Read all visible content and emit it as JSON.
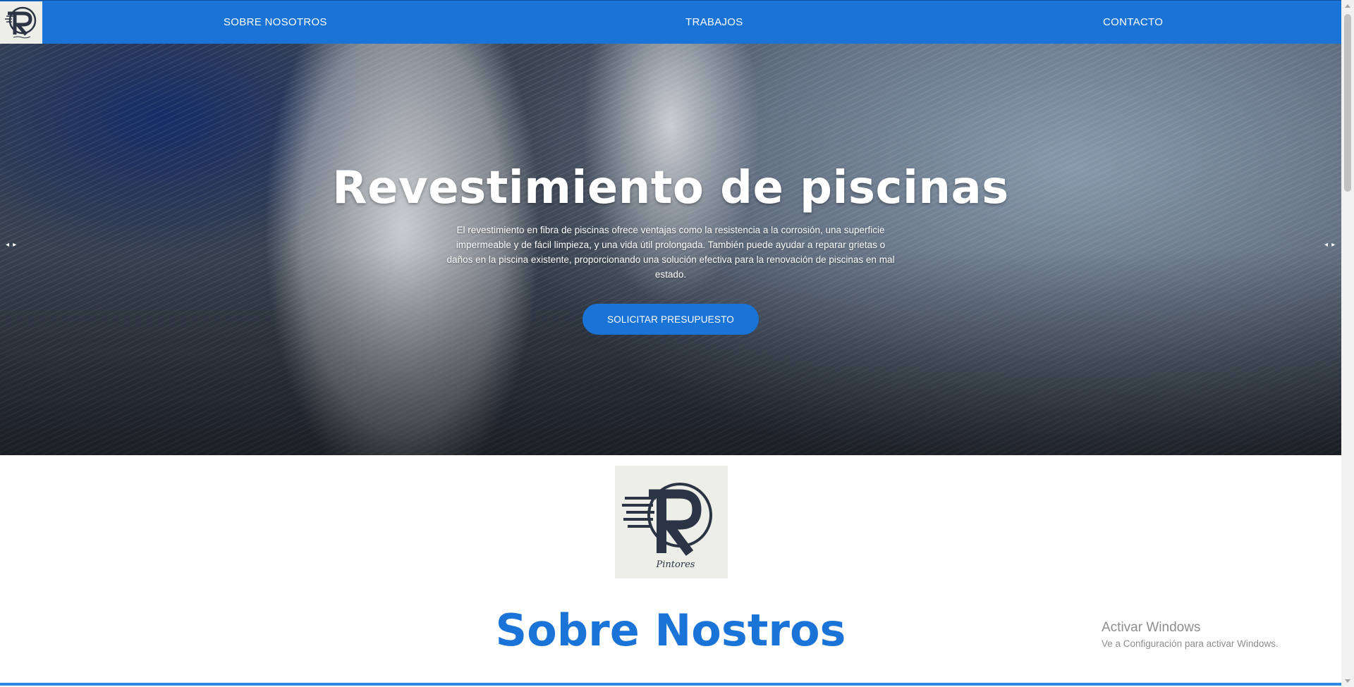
{
  "nav": {
    "logo_alt": "RD Pintores",
    "links": [
      "SOBRE NOSOTROS",
      "TRABAJOS",
      "CONTACTO"
    ]
  },
  "hero": {
    "title": "Revestimiento de piscinas",
    "description": "El revestimiento en fibra de piscinas ofrece ventajas como la resistencia a la corrosión, una superficie impermeable y de fácil limpieza, y una vida útil prolongada. También puede ayudar a reparar grietas o daños en la piscina existente, proporcionando una solución efectiva para la renovación de piscinas en mal estado.",
    "cta_label": "SOLICITAR PRESUPUESTO",
    "prev_arrow": "◂ ▸",
    "next_arrow": "◂ ▸"
  },
  "about": {
    "logo_text": "Pintores",
    "title": "Sobre Nostros"
  },
  "watermark": {
    "title": "Activar Windows",
    "subtitle": "Ve a Configuración para activar Windows."
  },
  "colors": {
    "brand_blue": "#1a73d6",
    "logo_bg": "#eeeee8",
    "logo_ink": "#2b3444"
  },
  "icons": [
    "rd-logo-icon",
    "carousel-prev-icon",
    "carousel-next-icon"
  ]
}
